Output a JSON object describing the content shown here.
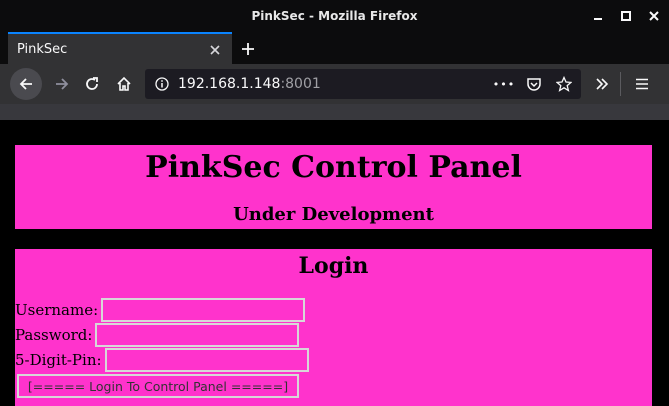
{
  "window": {
    "title": "PinkSec - Mozilla Firefox"
  },
  "tabs": [
    {
      "label": "PinkSec"
    }
  ],
  "urlbar": {
    "host": "192.168.1.148",
    "port": ":8001",
    "actions_dots": "•••"
  },
  "page": {
    "header_title": "PinkSec Control Panel",
    "header_subtitle": "Under Development",
    "login_title": "Login",
    "username_label": "Username:",
    "password_label": "Password:",
    "pin_label": "5-Digit-Pin:",
    "login_button": "[===== Login To Control Panel =====]"
  },
  "colors": {
    "panel_bg": "#ff33cc",
    "page_bg": "#000000",
    "accent": "#0a84ff"
  }
}
